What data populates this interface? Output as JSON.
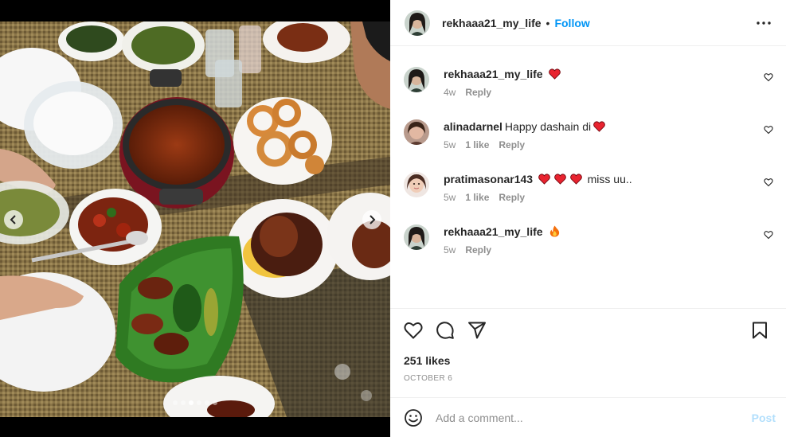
{
  "post": {
    "author": "rekhaaa21_my_life",
    "separator": "•",
    "follow_label": "Follow",
    "more_icon": "more-horizontal-icon"
  },
  "media": {
    "slide_count": 6,
    "active_slide": 2
  },
  "comments": [
    {
      "username": "rekhaaa21_my_life",
      "text": "",
      "emoji": "red-heart",
      "time": "4w",
      "likes": "",
      "reply_label": "Reply"
    },
    {
      "username": "alinadarnel",
      "text": "Happy dashain di",
      "emoji": "red-heart",
      "time": "5w",
      "likes": "1 like",
      "reply_label": "Reply"
    },
    {
      "username": "pratimasonar143",
      "text": "miss uu..",
      "emoji": "three-red-hearts",
      "time": "5w",
      "likes": "1 like",
      "reply_label": "Reply"
    },
    {
      "username": "rekhaaa21_my_life",
      "text": "",
      "emoji": "fire",
      "time": "5w",
      "likes": "",
      "reply_label": "Reply"
    }
  ],
  "actions": {
    "like_icon": "heart-icon",
    "comment_icon": "comment-icon",
    "share_icon": "send-icon",
    "save_icon": "bookmark-icon"
  },
  "likes_text": "251 likes",
  "date_text": "OCTOBER 6",
  "add_comment": {
    "placeholder": "Add a comment...",
    "post_label": "Post"
  },
  "colors": {
    "link_blue": "#0095f6",
    "post_disabled": "#b2dffc",
    "heart_red": "#ed4956",
    "muted": "#8e8e8e"
  }
}
